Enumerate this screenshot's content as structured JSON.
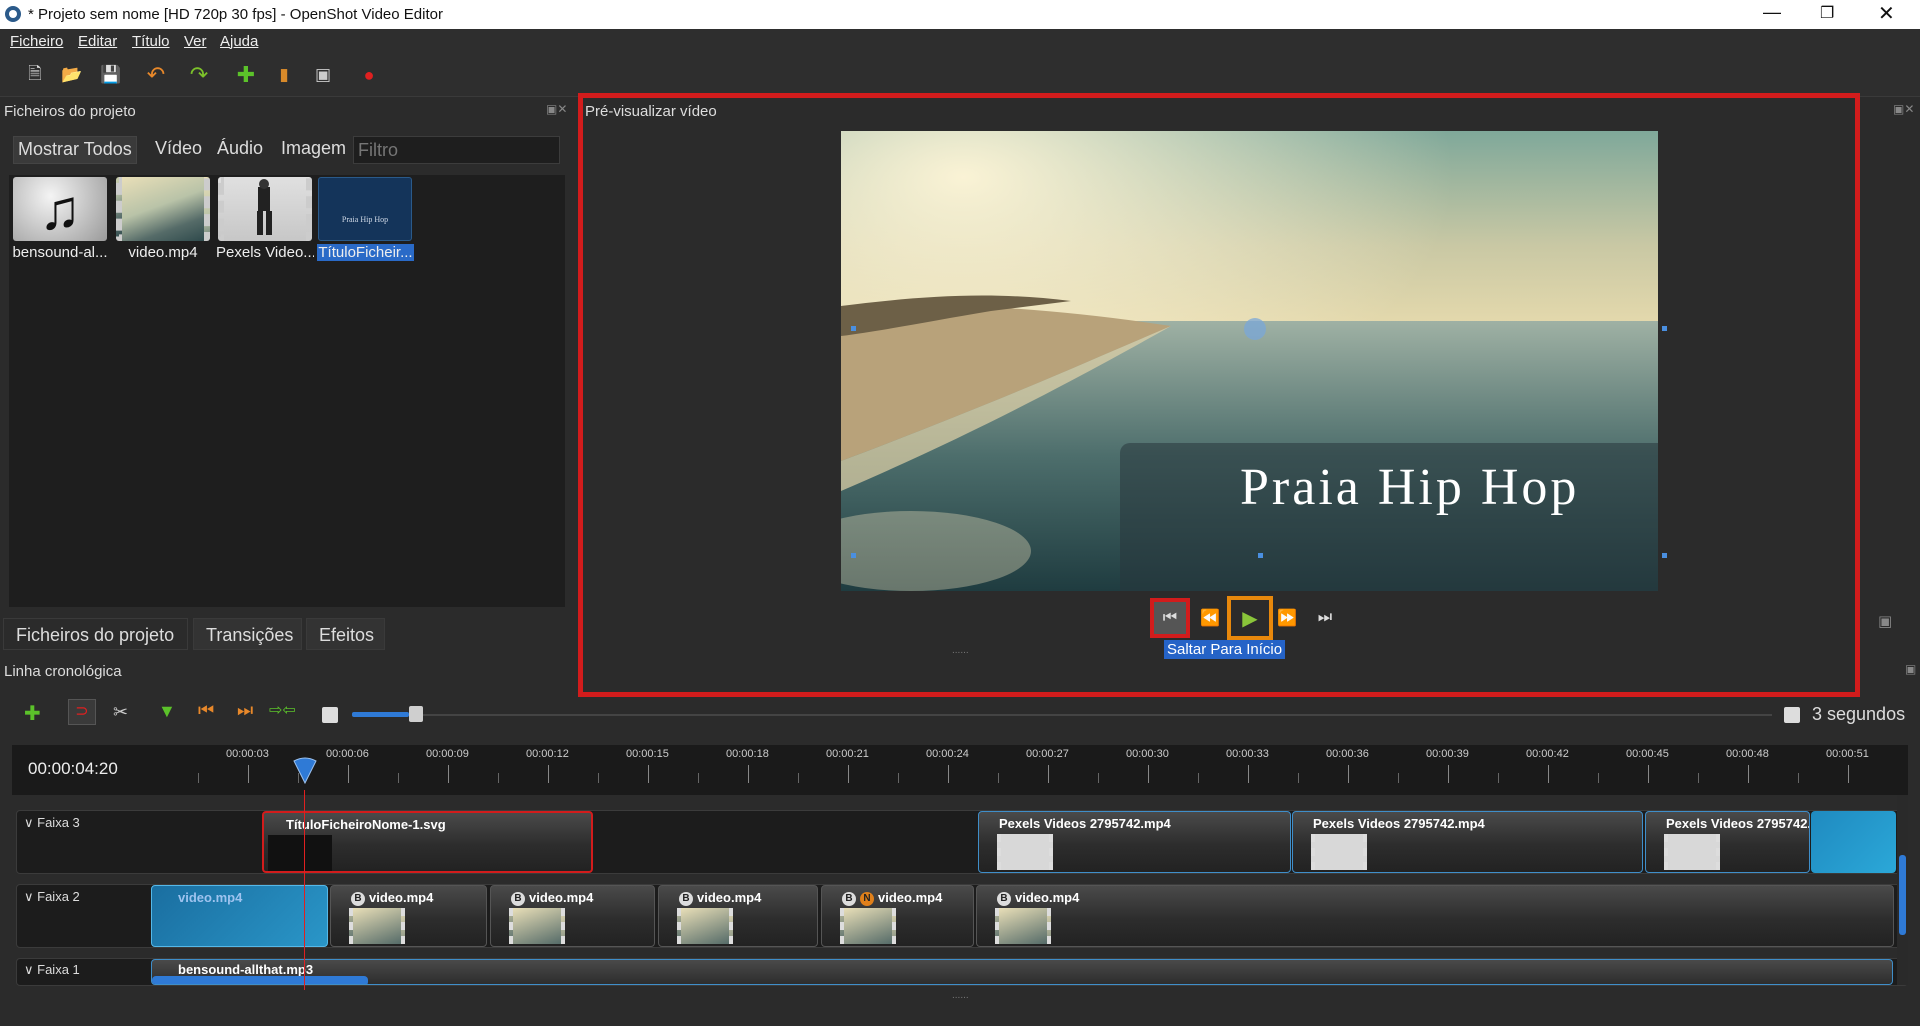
{
  "window": {
    "title": "* Projeto sem nome [HD 720p 30 fps] - OpenShot Video Editor"
  },
  "menu": [
    "Ficheiro",
    "Editar",
    "Título",
    "Ver",
    "Ajuda"
  ],
  "project_files": {
    "panel_title": "Ficheiros do projeto",
    "filters": [
      "Mostrar Todos",
      "Vídeo",
      "Áudio",
      "Imagem"
    ],
    "filter_placeholder": "Filtro",
    "files": [
      {
        "name": "bensound-al...",
        "type": "audio"
      },
      {
        "name": "video.mp4",
        "type": "video"
      },
      {
        "name": "Pexels Video...",
        "type": "video"
      },
      {
        "name": "TítuloFicheir...",
        "type": "title",
        "selected": true,
        "thumb_text": "Praia Hip Hop"
      }
    ],
    "tabs": [
      "Ficheiros do projeto",
      "Transições",
      "Efeitos"
    ]
  },
  "preview": {
    "panel_title": "Pré-visualizar vídeo",
    "overlay_title": "Praia Hip Hop",
    "tooltip": "Saltar Para Início",
    "highlight_color": "#d21c1c",
    "play_highlight_color": "#e8880c"
  },
  "timeline": {
    "panel_title": "Linha cronológica",
    "current_time": "00:00:04:20",
    "zoom_label": "3 segundos",
    "zoom_level": 0.2,
    "ticks": [
      "00:00:03",
      "00:00:06",
      "00:00:09",
      "00:00:12",
      "00:00:15",
      "00:00:18",
      "00:00:21",
      "00:00:24",
      "00:00:27",
      "00:00:30",
      "00:00:33",
      "00:00:36",
      "00:00:39",
      "00:00:42",
      "00:00:45",
      "00:00:48",
      "00:00:51"
    ],
    "tracks": [
      {
        "name": "Faixa 3",
        "clips": [
          "TítuloFicheiroNome-1.svg",
          "Pexels Videos 2795742.mp4",
          "Pexels Videos 2795742.mp4",
          "Pexels Videos 2795742.mp4"
        ]
      },
      {
        "name": "Faixa 2",
        "clips": [
          "video.mp4",
          "video.mp4",
          "video.mp4",
          "video.mp4",
          "video.mp4",
          "video.mp4"
        ]
      },
      {
        "name": "Faixa 1",
        "clips": [
          "bensound-allthat.mp3"
        ]
      }
    ],
    "badges": {
      "b": "B",
      "n": "N"
    }
  }
}
